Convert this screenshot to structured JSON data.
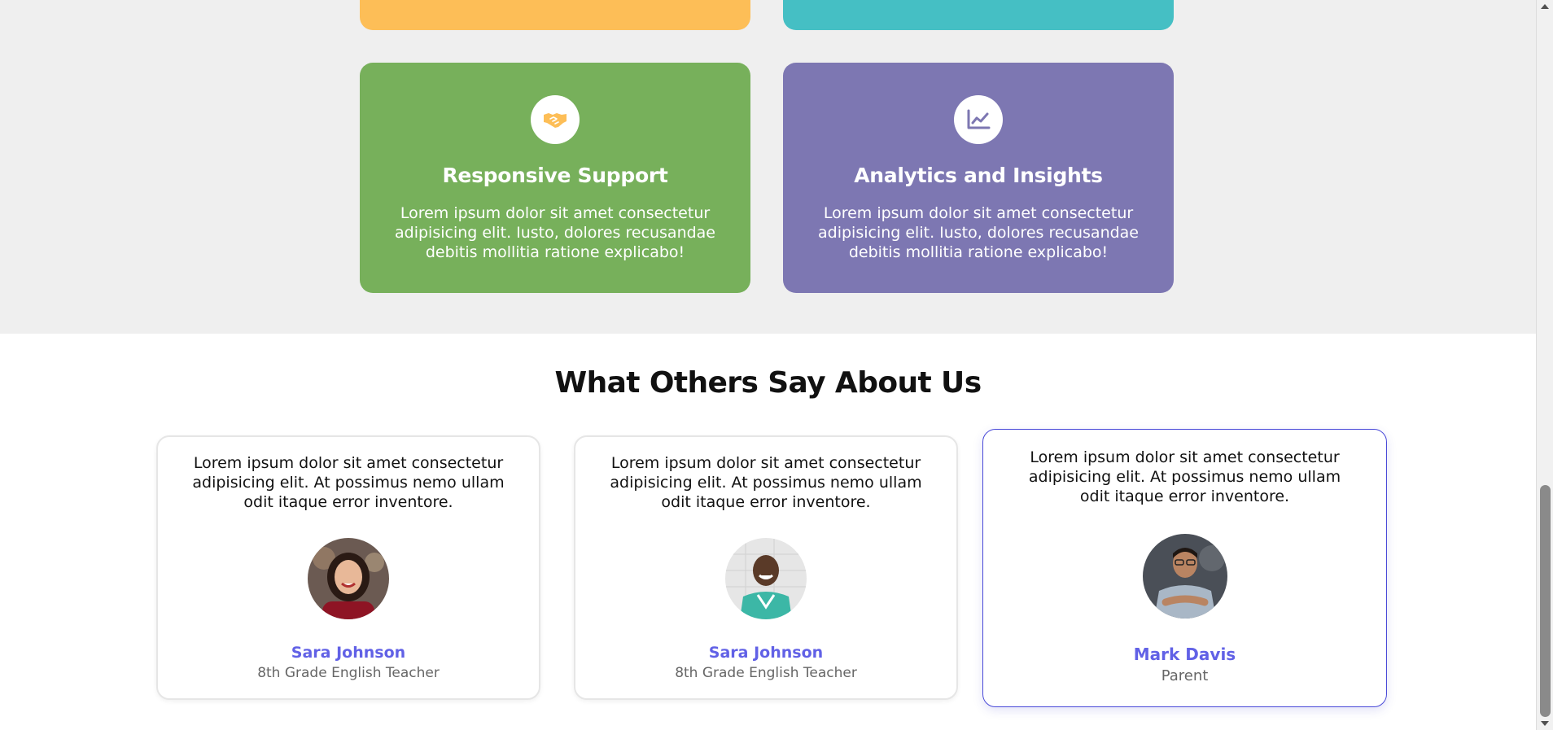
{
  "colors": {
    "yellow": "#fdbe57",
    "teal": "#45bfc4",
    "green": "#77b05b",
    "purple": "#7d77b2",
    "accent_name": "#6161e6",
    "highlight_border": "#4a4ad8"
  },
  "features": [
    {
      "title": "Responsive Support",
      "icon": "handshake-icon",
      "text": "Lorem ipsum dolor sit amet consectetur adipisicing elit. Iusto, dolores recusandae debitis mollitia ratione explicabo!"
    },
    {
      "title": "Analytics and Insights",
      "icon": "chart-line-icon",
      "text": "Lorem ipsum dolor sit amet consectetur adipisicing elit. Iusto, dolores recusandae debitis mollitia ratione explicabo!"
    }
  ],
  "testimonials": {
    "title": "What Others Say About Us",
    "items": [
      {
        "quote": "Lorem ipsum dolor sit amet consectetur adipisicing elit. At possimus nemo ullam odit itaque error inventore.",
        "name": "Sara Johnson",
        "role": "8th Grade English Teacher"
      },
      {
        "quote": "Lorem ipsum dolor sit amet consectetur adipisicing elit. At possimus nemo ullam odit itaque error inventore.",
        "name": "Sara Johnson",
        "role": "8th Grade English Teacher"
      },
      {
        "quote": "Lorem ipsum dolor sit amet consectetur adipisicing elit. At possimus nemo ullam odit itaque error inventore.",
        "name": "Mark Davis",
        "role": "Parent"
      }
    ]
  }
}
